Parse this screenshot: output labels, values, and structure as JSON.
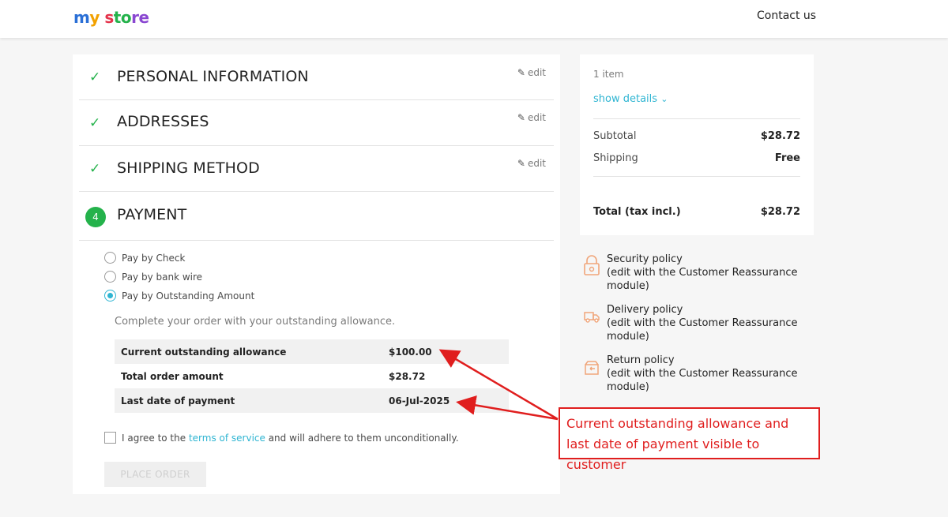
{
  "header": {
    "logo_parts": [
      "m",
      "y",
      " s",
      "to",
      "re"
    ],
    "contact": "Contact us"
  },
  "steps": [
    {
      "title": "PERSONAL INFORMATION",
      "edit": "edit",
      "done": true
    },
    {
      "title": "ADDRESSES",
      "edit": "edit",
      "done": true
    },
    {
      "title": "SHIPPING METHOD",
      "edit": "edit",
      "done": true
    },
    {
      "title": "PAYMENT",
      "number": "4"
    }
  ],
  "payment": {
    "options": [
      {
        "label": "Pay by Check",
        "selected": false
      },
      {
        "label": "Pay by bank wire",
        "selected": false
      },
      {
        "label": "Pay by Outstanding Amount",
        "selected": true
      }
    ],
    "description": "Complete your order with your outstanding allowance.",
    "table": [
      {
        "key": "Current outstanding allowance",
        "value": "$100.00"
      },
      {
        "key": "Total order amount",
        "value": "$28.72"
      },
      {
        "key": "Last date of payment",
        "value": "06-Jul-2025"
      }
    ],
    "agree_pre": "I agree to the ",
    "agree_link": "terms of service",
    "agree_post": " and will adhere to them unconditionally.",
    "place_order": "PLACE ORDER"
  },
  "summary": {
    "items": "1 item",
    "show_details": "show details",
    "subtotal_label": "Subtotal",
    "subtotal_value": "$28.72",
    "shipping_label": "Shipping",
    "shipping_value": "Free",
    "total_label": "Total (tax incl.)",
    "total_value": "$28.72"
  },
  "reassurance": [
    {
      "title": "Security policy",
      "sub": "(edit with the Customer Reassurance module)",
      "icon": "lock-icon"
    },
    {
      "title": "Delivery policy",
      "sub": "(edit with the Customer Reassurance module)",
      "icon": "truck-icon"
    },
    {
      "title": "Return policy",
      "sub": "(edit with the Customer Reassurance module)",
      "icon": "return-box-icon"
    }
  ],
  "annotation": {
    "line1": "Current outstanding allowance and",
    "line2": "last date of payment visible to customer"
  },
  "colors": {
    "accent": "#2fb5d2",
    "success": "#24b24b",
    "annotation": "#e01e1e"
  }
}
